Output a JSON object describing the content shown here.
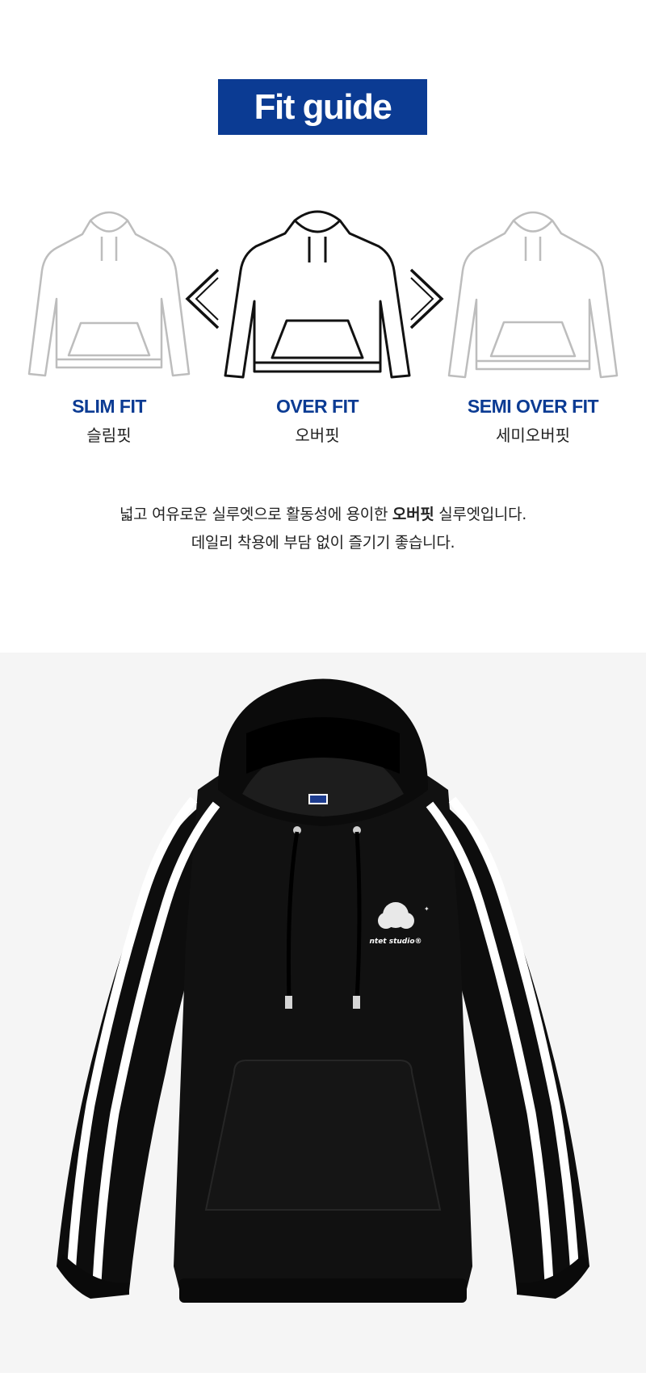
{
  "header": {
    "title": "Fit guide"
  },
  "fits": [
    {
      "name": "SLIM FIT",
      "korean": "슬림핏"
    },
    {
      "name": "OVER FIT",
      "korean": "오버핏"
    },
    {
      "name": "SEMI OVER FIT",
      "korean": "세미오버핏"
    }
  ],
  "description": {
    "line1_before": "넓고 여유로운 실루엣으로 활동성에 용이한 ",
    "line1_bold": "오버핏",
    "line1_after": " 실루엣입니다.",
    "line2": "데일리 착용에 부담 없이 즐기기 좋습니다."
  },
  "product": {
    "label_tag": "Ntet",
    "logo_text": "ntet studio®",
    "colors": {
      "body": "#0b0b0b",
      "stripe": "#ffffff"
    }
  },
  "colors": {
    "accent": "#0b3b93",
    "photo_bg": "#f5f5f5"
  }
}
